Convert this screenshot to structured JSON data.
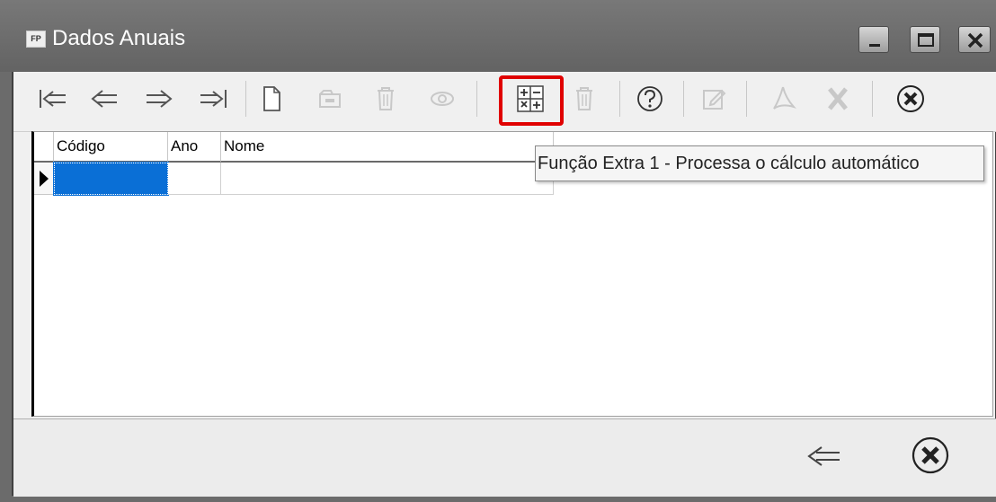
{
  "window": {
    "app_badge": "FP",
    "title": "Dados Anuais"
  },
  "toolbar": {
    "buttons": [
      {
        "name": "first-record",
        "icon": "first-icon",
        "enabled": true
      },
      {
        "name": "prev-record",
        "icon": "prev-icon",
        "enabled": true
      },
      {
        "name": "next-record",
        "icon": "next-icon",
        "enabled": true
      },
      {
        "name": "last-record",
        "icon": "last-icon",
        "enabled": true
      },
      {
        "name": "new",
        "icon": "new-document-icon",
        "enabled": true
      },
      {
        "name": "edit",
        "icon": "edit-folder-icon",
        "enabled": false
      },
      {
        "name": "delete",
        "icon": "trash-icon",
        "enabled": false
      },
      {
        "name": "view",
        "icon": "eye-icon",
        "enabled": false
      },
      {
        "name": "extra-function",
        "icon": "calculator-icon",
        "enabled": true,
        "highlighted": true
      },
      {
        "name": "delete-extra",
        "icon": "trash-icon",
        "enabled": false
      },
      {
        "name": "help",
        "icon": "help-icon",
        "enabled": true
      },
      {
        "name": "edit-note",
        "icon": "pencil-icon",
        "enabled": false
      },
      {
        "name": "pdf",
        "icon": "pdf-icon",
        "enabled": false
      },
      {
        "name": "excel",
        "icon": "excel-icon",
        "enabled": false
      },
      {
        "name": "close",
        "icon": "close-circle-icon",
        "enabled": true
      }
    ]
  },
  "grid": {
    "columns": [
      "Código",
      "Ano",
      "Nome"
    ],
    "rows": [
      [
        "",
        "",
        ""
      ]
    ]
  },
  "tooltip": {
    "text": "Função Extra 1 - Processa o cálculo automático"
  },
  "colors": {
    "titlebar": "#6b6b6b",
    "highlight": "#e00000",
    "selection": "#0a6fd6"
  }
}
